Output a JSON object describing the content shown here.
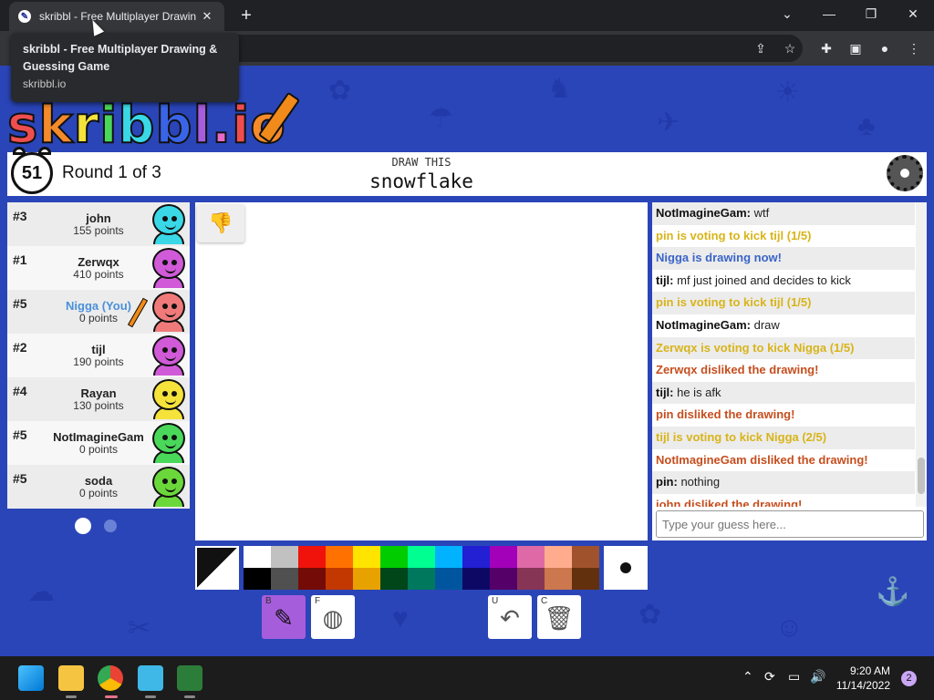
{
  "browser": {
    "tab_title": "skribbl - Free Multiplayer Drawing & Guessing Game",
    "tab_title_visible": "skribbl - Free Multiplayer Drawin",
    "tab_close": "✕",
    "new_tab": "+",
    "controls": {
      "collapse": "⌄",
      "minimize": "—",
      "restore": "❐",
      "close": "✕"
    },
    "tooltip": {
      "title_line1": "skribbl - Free Multiplayer Drawing &",
      "title_line2": "Guessing Game",
      "url": "skribbl.io"
    },
    "toolbar_icons": [
      "share-icon",
      "star-icon",
      "extensions-icon",
      "sidepanel-icon",
      "profile-icon",
      "menu-icon"
    ]
  },
  "game": {
    "logo": "skribbl.io",
    "timer": "51",
    "round": "Round 1 of 3",
    "draw_label": "DRAW THIS",
    "word": "snowflake",
    "players": [
      {
        "rank": "#3",
        "name": "john",
        "points": "155 points",
        "color": "#3ad8e6"
      },
      {
        "rank": "#1",
        "name": "Zerwqx",
        "points": "410 points",
        "color": "#d05ad8"
      },
      {
        "rank": "#5",
        "name": "Nigga (You)",
        "points": "0 points",
        "color": "#f07a7a"
      },
      {
        "rank": "#2",
        "name": "tijl",
        "points": "190 points",
        "color": "#d05ad8"
      },
      {
        "rank": "#4",
        "name": "Rayan",
        "points": "130 points",
        "color": "#f5e23a"
      },
      {
        "rank": "#5",
        "name": "NotImagineGam",
        "points": "0 points",
        "color": "#4ad85a"
      },
      {
        "rank": "#5",
        "name": "soda",
        "points": "0 points",
        "color": "#6ad83a"
      }
    ],
    "chat": [
      {
        "author": "NotImagineGam:",
        "text": " wtf",
        "style": "text"
      },
      {
        "text": "pin is voting to kick tijl (1/5)",
        "style": "yellow"
      },
      {
        "text": "Nigga is drawing now!",
        "style": "blue"
      },
      {
        "author": "tijl:",
        "text": " mf just joined and decides to kick",
        "style": "text"
      },
      {
        "text": "pin is voting to kick tijl (1/5)",
        "style": "yellow"
      },
      {
        "author": "NotImagineGam:",
        "text": " draw",
        "style": "text"
      },
      {
        "text": "Zerwqx is voting to kick Nigga (1/5)",
        "style": "yellow"
      },
      {
        "text": "Zerwqx disliked the drawing!",
        "style": "red"
      },
      {
        "author": "tijl:",
        "text": " he is afk",
        "style": "text"
      },
      {
        "text": "pin disliked the drawing!",
        "style": "red"
      },
      {
        "text": "tijl is voting to kick Nigga (2/5)",
        "style": "yellow"
      },
      {
        "text": "NotImagineGam disliked the drawing!",
        "style": "red"
      },
      {
        "author": "pin:",
        "text": " nothing",
        "style": "text"
      },
      {
        "text": "john disliked the drawing!",
        "style": "red"
      }
    ],
    "guess_placeholder": "Type your guess here...",
    "palette": [
      "#ffffff",
      "#c1c1c1",
      "#ef130b",
      "#ff7100",
      "#ffe400",
      "#00cc00",
      "#00ff91",
      "#00b2ff",
      "#231fd3",
      "#a300ba",
      "#df69a7",
      "#ffac8e",
      "#a0522d",
      "#000000",
      "#505050",
      "#740b07",
      "#c23800",
      "#e8a200",
      "#004619",
      "#00785d",
      "#00569e",
      "#0e0865",
      "#550069",
      "#873554",
      "#cc774d",
      "#63300d"
    ],
    "tools": [
      {
        "key": "B",
        "name": "brush"
      },
      {
        "key": "F",
        "name": "fill"
      },
      {
        "key": "U",
        "name": "undo"
      },
      {
        "key": "C",
        "name": "clear"
      }
    ]
  },
  "taskbar": {
    "time": "9:20 AM",
    "date": "11/14/2022",
    "notifications": "2"
  }
}
